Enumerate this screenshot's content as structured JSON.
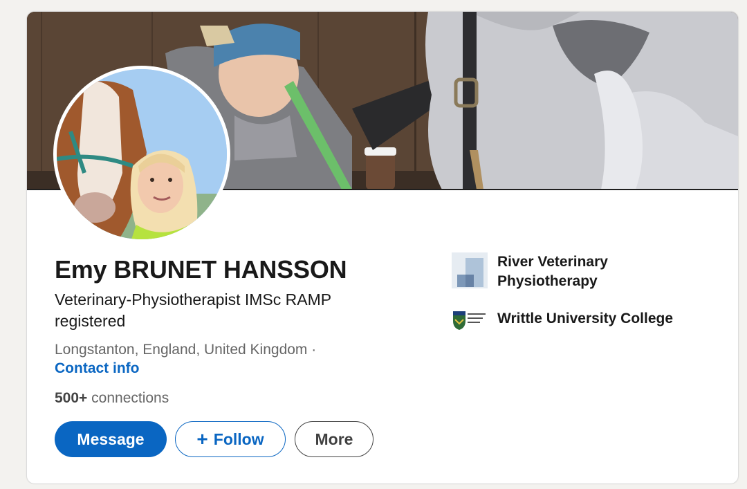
{
  "profile": {
    "name": "Emy BRUNET HANSSON",
    "headline": "Veterinary-Physiotherapist IMSc RAMP registered",
    "location": "Longstanton, England, United Kingdom ·",
    "contact_info": "Contact info",
    "connections_count": "500+",
    "connections_label": "connections"
  },
  "actions": {
    "message": "Message",
    "follow_plus": "+",
    "follow": "Follow",
    "more": "More"
  },
  "organizations": [
    {
      "name": "River Veterinary Physiotherapy",
      "icon": "company-logo"
    },
    {
      "name": "Writtle University College",
      "icon": "college-logo"
    }
  ],
  "colors": {
    "primary": "#0a66c2",
    "text": "#191919",
    "muted": "#666666"
  }
}
